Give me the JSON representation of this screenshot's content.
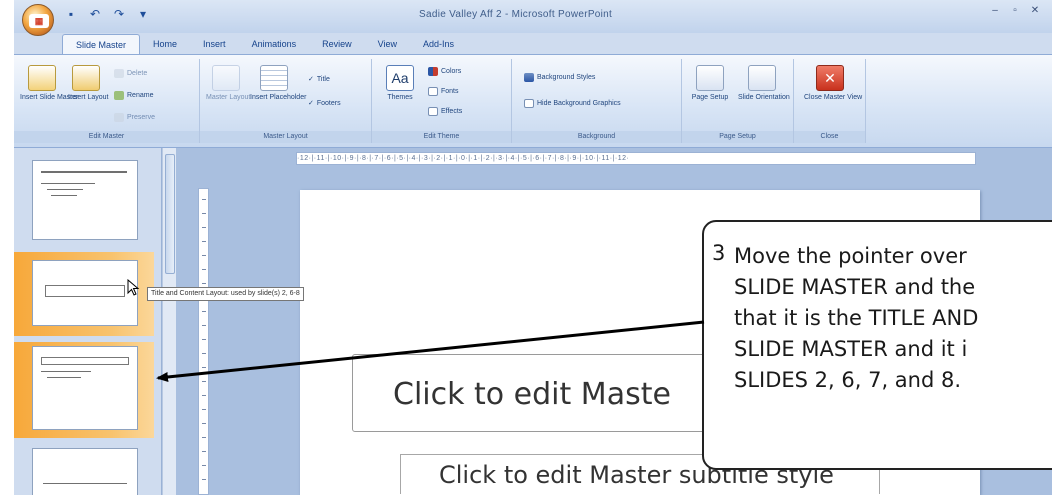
{
  "window": {
    "title": "Sadie Valley Aff 2 - Microsoft PowerPoint",
    "controls": [
      "–",
      "▫",
      "✕"
    ]
  },
  "tabs": [
    {
      "label": "Slide Master",
      "active": true
    },
    {
      "label": "Home"
    },
    {
      "label": "Insert"
    },
    {
      "label": "Animations"
    },
    {
      "label": "Review"
    },
    {
      "label": "View"
    },
    {
      "label": "Add-Ins"
    }
  ],
  "ribbon": {
    "edit_master": {
      "label": "Edit Master",
      "insert_slide_master": "Insert Slide Master",
      "insert_layout": "Insert Layout",
      "delete": "Delete",
      "rename": "Rename",
      "preserve": "Preserve"
    },
    "master_layout": {
      "label": "Master Layout",
      "master_layout_btn": "Master Layout",
      "insert_placeholder": "Insert Placeholder",
      "title": "Title",
      "footers": "Footers"
    },
    "edit_theme": {
      "label": "Edit Theme",
      "themes": "Themes",
      "colors": "Colors",
      "fonts": "Fonts",
      "effects": "Effects"
    },
    "background": {
      "label": "Background",
      "background_styles": "Background Styles",
      "hide_background_graphics": "Hide Background Graphics"
    },
    "page_setup": {
      "label": "Page Setup",
      "page_setup_btn": "Page Setup",
      "slide_orientation": "Slide Orientation"
    },
    "close": {
      "label": "Close",
      "close_master_view": "Close Master View"
    }
  },
  "ruler": {
    "ticks": "·12·|·11·|·10·|·9·|·8·|·7·|·6·|·5·|·4·|·3·|·2·|·1·|·0·|·1·|·2·|·3·|·4·|·5·|·6·|·7·|·8·|·9·|·10·|·11·|·12·"
  },
  "slide": {
    "title_placeholder": "Click to edit Maste",
    "body_placeholder": "Click to edit Master subtitle style"
  },
  "tooltip": {
    "text": "Title and Content Layout: used by slide(s) 2, 6-8"
  },
  "callout": {
    "number": "3",
    "lines": [
      "Move the pointer over",
      "SLIDE MASTER and the",
      "that it is the TITLE AND",
      "SLIDE MASTER and it i",
      "SLIDES 2, 6, 7, and 8."
    ]
  },
  "colors": {
    "accent_orange": "#f7a83a",
    "ribbon_blue": "#15428b"
  }
}
